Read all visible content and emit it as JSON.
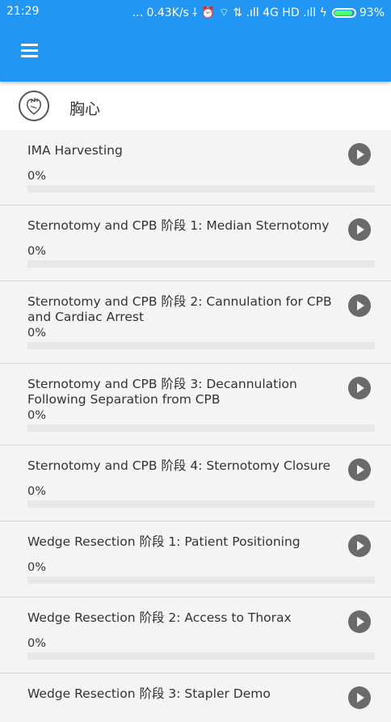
{
  "status_bar": {
    "time": "21:29",
    "network": "... 0.43K/s",
    "indicators": "⸸ ⏰ ⌔ ⇅ .ıll 4G HD .ıll ϟ",
    "battery": "93%"
  },
  "app_bar": {
    "menu_icon": "hamburger-menu-icon",
    "color": "#2196f3"
  },
  "section": {
    "icon": "heart-icon",
    "title": "胸心"
  },
  "procedures": [
    {
      "title": "IMA Harvesting",
      "progress_label": "0%",
      "progress": 0
    },
    {
      "title": "Sternotomy and CPB 阶段 1: Median Sternotomy",
      "progress_label": "0%",
      "progress": 0
    },
    {
      "title": "Sternotomy and CPB 阶段 2: Cannulation for CPB and Cardiac Arrest",
      "progress_label": "0%",
      "progress": 0
    },
    {
      "title": "Sternotomy and CPB 阶段 3: Decannulation Following Separation from CPB",
      "progress_label": "0%",
      "progress": 0
    },
    {
      "title": "Sternotomy and CPB 阶段 4: Sternotomy Closure",
      "progress_label": "0%",
      "progress": 0
    },
    {
      "title": "Wedge Resection 阶段 1: Patient Positioning",
      "progress_label": "0%",
      "progress": 0
    },
    {
      "title": "Wedge Resection 阶段 2: Access to Thorax",
      "progress_label": "0%",
      "progress": 0
    },
    {
      "title": "Wedge Resection 阶段 3: Stapler Demo",
      "progress_label": "",
      "progress": 0
    }
  ]
}
